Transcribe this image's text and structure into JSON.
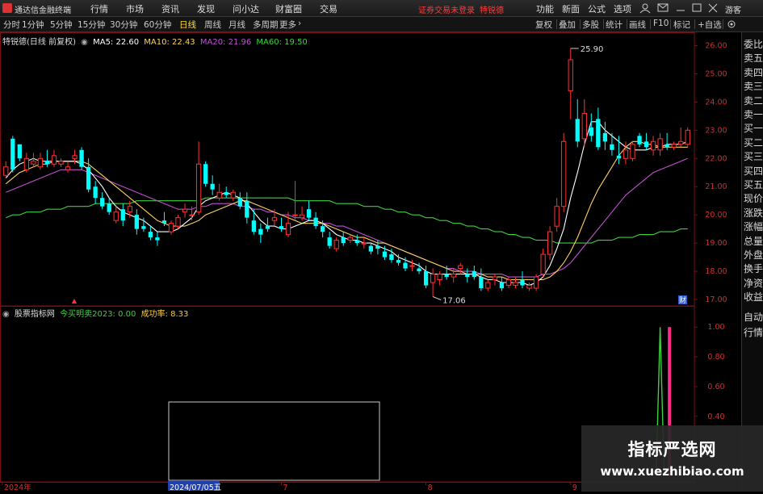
{
  "app": {
    "title": "通达信金融终端",
    "menu": [
      "行情",
      "市场",
      "资讯",
      "发现",
      "问小达",
      "财富圈",
      "交易"
    ],
    "notice": "证券交易未登录",
    "stock_name_top": "特锐德",
    "right_menu": [
      "功能",
      "新面",
      "公式",
      "选项"
    ],
    "guest": "游客"
  },
  "toolbar": {
    "periods": [
      "分时",
      "1分钟",
      "5分钟",
      "15分钟",
      "30分钟",
      "60分钟",
      "日线",
      "周线",
      "月线",
      "多周期",
      "更多"
    ],
    "active_period": "日线",
    "more_arrow": "›",
    "right_items": [
      "复权",
      "叠加",
      "多股",
      "统计",
      "画线",
      "F10",
      "标记",
      "+自选"
    ]
  },
  "price_info": {
    "label": "特锐德(日线 前复权)",
    "ma5": "MA5: 22.60",
    "ma10": "MA10: 22.43",
    "ma20": "MA20: 21.96",
    "ma60": "MA60: 19.50",
    "colors": {
      "ma5": "#ffffff",
      "ma10": "#ffd25a",
      "ma20": "#c050d0",
      "ma60": "#3cd03c"
    }
  },
  "indicator_info": {
    "label": "股票指标网",
    "today": "今买明卖2023: 0.00",
    "rate": "成功率: 8.33",
    "colors": {
      "today": "#3cd03c",
      "rate": "#ffcc33"
    }
  },
  "sidebar_items": [
    "委比",
    "卖五",
    "卖四",
    "卖三",
    "卖二",
    "卖一",
    "买一",
    "买二",
    "买三",
    "买四",
    "买五",
    "现价",
    "涨跌",
    "涨幅",
    "总量",
    "外盘",
    "换手",
    "净资",
    "收益",
    "自动",
    "行情"
  ],
  "annotations": {
    "max": "25.90",
    "min": "17.06",
    "fin_mark": "财",
    "event_mark": "▲"
  },
  "date_axis": {
    "labels": [
      "2024年",
      "7",
      "8",
      "9"
    ],
    "selected": "2024/07/05五"
  },
  "watermark": {
    "line1": "指标严选网",
    "line2": "www.xuezhibiao.com"
  },
  "chart_data": [
    {
      "type": "candlestick",
      "title": "特锐德(日线 前复权)",
      "y_ticks": [
        17.0,
        18.0,
        19.0,
        20.0,
        21.0,
        22.0,
        23.0,
        24.0,
        25.0,
        26.0
      ],
      "ylim": [
        16.8,
        26.3
      ],
      "up_color": "#ff3232",
      "down_color": "#00ffff",
      "ohlc": [
        [
          21.4,
          21.9,
          21.3,
          21.7
        ],
        [
          22.7,
          22.8,
          21.5,
          21.6
        ],
        [
          22.5,
          22.5,
          21.9,
          22.0
        ],
        [
          21.6,
          22.2,
          21.5,
          22.0
        ],
        [
          21.8,
          22.2,
          21.7,
          21.9
        ],
        [
          21.7,
          22.2,
          21.6,
          22.0
        ],
        [
          21.9,
          22.3,
          21.7,
          21.8
        ],
        [
          21.8,
          22.3,
          21.7,
          22.1
        ],
        [
          21.8,
          22.0,
          21.7,
          21.9
        ],
        [
          21.6,
          21.9,
          21.5,
          21.7
        ],
        [
          22.0,
          22.3,
          21.8,
          22.1
        ],
        [
          22.3,
          22.4,
          21.6,
          21.7
        ],
        [
          21.7,
          22.0,
          20.8,
          20.9
        ],
        [
          21.0,
          21.2,
          20.4,
          20.6
        ],
        [
          20.6,
          20.8,
          20.2,
          20.3
        ],
        [
          20.4,
          20.6,
          20.0,
          20.1
        ],
        [
          19.8,
          20.3,
          19.7,
          20.1
        ],
        [
          20.2,
          20.4,
          19.6,
          19.8
        ],
        [
          20.1,
          20.5,
          19.9,
          20.3
        ],
        [
          20.0,
          20.2,
          19.3,
          19.5
        ],
        [
          19.6,
          19.9,
          19.4,
          19.5
        ],
        [
          19.4,
          19.6,
          19.1,
          19.2
        ],
        [
          19.2,
          19.4,
          18.9,
          19.1
        ],
        [
          19.8,
          20.1,
          19.6,
          19.7
        ],
        [
          19.4,
          19.8,
          19.3,
          19.7
        ],
        [
          19.6,
          20.0,
          19.5,
          19.9
        ],
        [
          20.1,
          20.4,
          19.9,
          20.2
        ],
        [
          20.0,
          20.3,
          19.8,
          20.0
        ],
        [
          20.1,
          22.6,
          20.0,
          21.8
        ],
        [
          21.8,
          21.9,
          21.0,
          21.1
        ],
        [
          21.1,
          21.4,
          20.7,
          20.9
        ],
        [
          20.6,
          21.1,
          20.5,
          20.8
        ],
        [
          20.8,
          21.0,
          20.6,
          20.7
        ],
        [
          20.6,
          20.9,
          20.5,
          20.8
        ],
        [
          20.6,
          20.8,
          20.2,
          20.3
        ],
        [
          20.5,
          20.8,
          19.7,
          19.9
        ],
        [
          19.8,
          20.2,
          19.3,
          19.4
        ],
        [
          19.5,
          19.7,
          19.0,
          19.3
        ],
        [
          19.6,
          19.9,
          19.4,
          19.5
        ],
        [
          19.8,
          20.2,
          19.6,
          19.9
        ],
        [
          19.6,
          19.9,
          19.4,
          19.5
        ],
        [
          19.3,
          20.1,
          19.2,
          19.7
        ],
        [
          20.0,
          21.2,
          19.8,
          20.0
        ],
        [
          19.9,
          20.3,
          19.8,
          20.0
        ],
        [
          20.2,
          20.5,
          19.8,
          19.9
        ],
        [
          19.9,
          20.1,
          19.5,
          19.6
        ],
        [
          19.6,
          19.8,
          19.2,
          19.4
        ],
        [
          19.2,
          19.4,
          18.8,
          18.9
        ],
        [
          18.8,
          19.2,
          18.7,
          19.1
        ],
        [
          19.2,
          19.4,
          18.9,
          19.0
        ],
        [
          19.1,
          19.3,
          19.0,
          19.2
        ],
        [
          19.1,
          19.3,
          18.9,
          19.0
        ],
        [
          19.0,
          19.2,
          18.8,
          19.0
        ],
        [
          18.9,
          19.0,
          18.6,
          18.7
        ],
        [
          18.9,
          19.1,
          18.6,
          18.8
        ],
        [
          18.7,
          18.9,
          18.4,
          18.5
        ],
        [
          18.6,
          18.8,
          18.3,
          18.4
        ],
        [
          18.4,
          18.6,
          18.2,
          18.3
        ],
        [
          18.3,
          18.5,
          18.0,
          18.1
        ],
        [
          18.2,
          18.4,
          18.0,
          18.2
        ],
        [
          18.1,
          18.3,
          17.9,
          18.0
        ],
        [
          18.0,
          18.2,
          17.4,
          17.5
        ],
        [
          17.6,
          18.1,
          17.1,
          17.9
        ],
        [
          17.7,
          18.0,
          17.5,
          17.9
        ],
        [
          17.9,
          18.2,
          17.7,
          17.8
        ],
        [
          17.8,
          18.1,
          17.6,
          17.9
        ],
        [
          18.1,
          18.3,
          17.9,
          18.2
        ],
        [
          17.9,
          18.1,
          17.6,
          17.8
        ],
        [
          18.0,
          18.2,
          17.7,
          17.8
        ],
        [
          17.8,
          18.1,
          17.3,
          17.4
        ],
        [
          17.4,
          17.7,
          17.3,
          17.6
        ],
        [
          17.7,
          17.9,
          17.5,
          17.8
        ],
        [
          17.6,
          17.8,
          17.3,
          17.4
        ],
        [
          17.5,
          17.8,
          17.4,
          17.7
        ],
        [
          17.5,
          17.8,
          17.4,
          17.6
        ],
        [
          17.7,
          18.0,
          17.4,
          17.5
        ],
        [
          17.4,
          17.6,
          17.3,
          17.5
        ],
        [
          17.4,
          17.9,
          17.3,
          17.8
        ],
        [
          17.9,
          18.8,
          17.8,
          18.6
        ],
        [
          18.6,
          19.6,
          18.4,
          19.4
        ],
        [
          19.6,
          20.6,
          19.4,
          20.3
        ],
        [
          20.3,
          22.9,
          20.1,
          22.6
        ],
        [
          24.4,
          25.9,
          23.4,
          25.5
        ],
        [
          23.4,
          24.1,
          22.4,
          22.6
        ],
        [
          22.7,
          24.1,
          22.4,
          23.6
        ],
        [
          23.1,
          23.6,
          22.6,
          22.8
        ],
        [
          23.4,
          23.8,
          22.3,
          22.4
        ],
        [
          22.9,
          23.3,
          22.3,
          22.6
        ],
        [
          22.5,
          22.9,
          22.1,
          22.3
        ],
        [
          22.1,
          22.8,
          21.8,
          22.0
        ],
        [
          22.0,
          22.6,
          21.8,
          22.3
        ],
        [
          22.0,
          22.6,
          21.9,
          22.5
        ],
        [
          22.8,
          22.9,
          22.4,
          22.5
        ],
        [
          22.6,
          22.9,
          22.3,
          22.4
        ],
        [
          22.3,
          22.8,
          22.1,
          22.6
        ],
        [
          22.3,
          22.9,
          22.1,
          22.7
        ],
        [
          22.5,
          22.9,
          22.3,
          22.4
        ],
        [
          22.4,
          22.6,
          22.3,
          22.5
        ],
        [
          22.5,
          23.1,
          22.4,
          22.6
        ],
        [
          22.5,
          23.1,
          22.4,
          23.0
        ]
      ],
      "ma_lines": {
        "MA5": [
          21.3,
          21.6,
          21.8,
          21.9,
          22.0,
          21.9,
          21.9,
          21.9,
          21.9,
          21.9,
          21.9,
          21.8,
          21.6,
          21.3,
          21.0,
          20.6,
          20.3,
          20.1,
          20.0,
          19.9,
          19.8,
          19.6,
          19.4,
          19.4,
          19.4,
          19.5,
          19.7,
          19.9,
          20.3,
          20.5,
          20.6,
          20.7,
          20.8,
          20.7,
          20.6,
          20.4,
          20.1,
          19.8,
          19.6,
          19.6,
          19.5,
          19.5,
          19.6,
          19.7,
          19.8,
          19.8,
          19.7,
          19.5,
          19.3,
          19.2,
          19.1,
          19.1,
          19.0,
          19.0,
          18.9,
          18.8,
          18.7,
          18.5,
          18.4,
          18.3,
          18.2,
          18.0,
          17.9,
          17.9,
          17.9,
          17.9,
          17.9,
          17.9,
          17.9,
          17.8,
          17.7,
          17.7,
          17.6,
          17.6,
          17.6,
          17.6,
          17.5,
          17.6,
          17.8,
          18.2,
          18.8,
          19.5,
          20.6,
          21.5,
          22.5,
          23.3,
          23.3,
          23.0,
          22.8,
          22.6,
          22.4,
          22.3,
          22.3,
          22.3,
          22.4,
          22.4,
          22.5,
          22.5,
          22.5,
          22.6
        ],
        "MA10": [
          21.1,
          21.3,
          21.5,
          21.6,
          21.7,
          21.8,
          21.8,
          21.9,
          21.9,
          21.9,
          21.9,
          21.9,
          21.8,
          21.6,
          21.4,
          21.2,
          21.0,
          20.8,
          20.6,
          20.4,
          20.2,
          20.0,
          19.8,
          19.7,
          19.6,
          19.6,
          19.6,
          19.7,
          19.8,
          20.0,
          20.1,
          20.2,
          20.3,
          20.4,
          20.5,
          20.5,
          20.4,
          20.3,
          20.2,
          20.1,
          20.0,
          19.9,
          19.8,
          19.7,
          19.7,
          19.7,
          19.7,
          19.6,
          19.5,
          19.4,
          19.3,
          19.2,
          19.2,
          19.1,
          19.0,
          19.0,
          18.9,
          18.8,
          18.7,
          18.6,
          18.5,
          18.4,
          18.3,
          18.2,
          18.1,
          18.0,
          18.0,
          17.9,
          17.9,
          17.9,
          17.8,
          17.8,
          17.8,
          17.7,
          17.7,
          17.7,
          17.7,
          17.7,
          17.7,
          17.8,
          18.0,
          18.3,
          18.7,
          19.2,
          19.8,
          20.4,
          20.9,
          21.3,
          21.7,
          22.1,
          22.4,
          22.6,
          22.6,
          22.5,
          22.5,
          22.4,
          22.4,
          22.4,
          22.4,
          22.4
        ],
        "MA20": [
          20.8,
          20.9,
          21.0,
          21.1,
          21.2,
          21.3,
          21.4,
          21.5,
          21.6,
          21.6,
          21.6,
          21.6,
          21.5,
          21.4,
          21.3,
          21.2,
          21.1,
          21.0,
          20.9,
          20.8,
          20.7,
          20.6,
          20.5,
          20.4,
          20.3,
          20.2,
          20.2,
          20.2,
          20.3,
          20.3,
          20.4,
          20.4,
          20.4,
          20.4,
          20.3,
          20.3,
          20.2,
          20.2,
          20.1,
          20.1,
          20.0,
          20.0,
          19.9,
          19.9,
          19.8,
          19.8,
          19.7,
          19.7,
          19.6,
          19.6,
          19.5,
          19.4,
          19.3,
          19.2,
          19.1,
          19.0,
          18.9,
          18.8,
          18.7,
          18.6,
          18.5,
          18.4,
          18.3,
          18.2,
          18.1,
          18.1,
          18.0,
          18.0,
          18.0,
          17.9,
          17.9,
          17.9,
          17.9,
          17.8,
          17.8,
          17.8,
          17.8,
          17.8,
          17.9,
          17.9,
          18.0,
          18.1,
          18.3,
          18.6,
          18.9,
          19.2,
          19.5,
          19.8,
          20.1,
          20.4,
          20.7,
          20.9,
          21.1,
          21.3,
          21.5,
          21.6,
          21.7,
          21.8,
          21.9,
          22.0
        ],
        "MA60": [
          19.9,
          20.0,
          20.0,
          20.1,
          20.1,
          20.1,
          20.2,
          20.2,
          20.2,
          20.3,
          20.3,
          20.3,
          20.3,
          20.4,
          20.4,
          20.4,
          20.4,
          20.4,
          20.4,
          20.5,
          20.5,
          20.5,
          20.5,
          20.5,
          20.5,
          20.5,
          20.5,
          20.5,
          20.5,
          20.6,
          20.6,
          20.6,
          20.6,
          20.6,
          20.6,
          20.6,
          20.6,
          20.6,
          20.6,
          20.6,
          20.6,
          20.6,
          20.5,
          20.5,
          20.5,
          20.5,
          20.5,
          20.5,
          20.4,
          20.4,
          20.4,
          20.4,
          20.3,
          20.3,
          20.3,
          20.2,
          20.2,
          20.1,
          20.1,
          20.0,
          20.0,
          19.9,
          19.9,
          19.8,
          19.8,
          19.7,
          19.7,
          19.6,
          19.6,
          19.5,
          19.5,
          19.4,
          19.4,
          19.3,
          19.3,
          19.2,
          19.2,
          19.1,
          19.1,
          19.1,
          19.0,
          19.0,
          19.0,
          19.0,
          19.0,
          19.0,
          19.1,
          19.1,
          19.1,
          19.2,
          19.2,
          19.2,
          19.3,
          19.3,
          19.3,
          19.4,
          19.4,
          19.4,
          19.5,
          19.5
        ]
      }
    },
    {
      "type": "line",
      "title": "股票指标网",
      "y_ticks": [
        0.4,
        0.6,
        0.8,
        1.0
      ],
      "ylim": [
        -0.03,
        1.05
      ],
      "series": [
        {
          "name": "今买明卖2023",
          "values_note": "signal spike",
          "spike_index": 95,
          "spike_value": 1.0
        }
      ],
      "bar_index": 96,
      "bar_value": 1.0
    }
  ]
}
